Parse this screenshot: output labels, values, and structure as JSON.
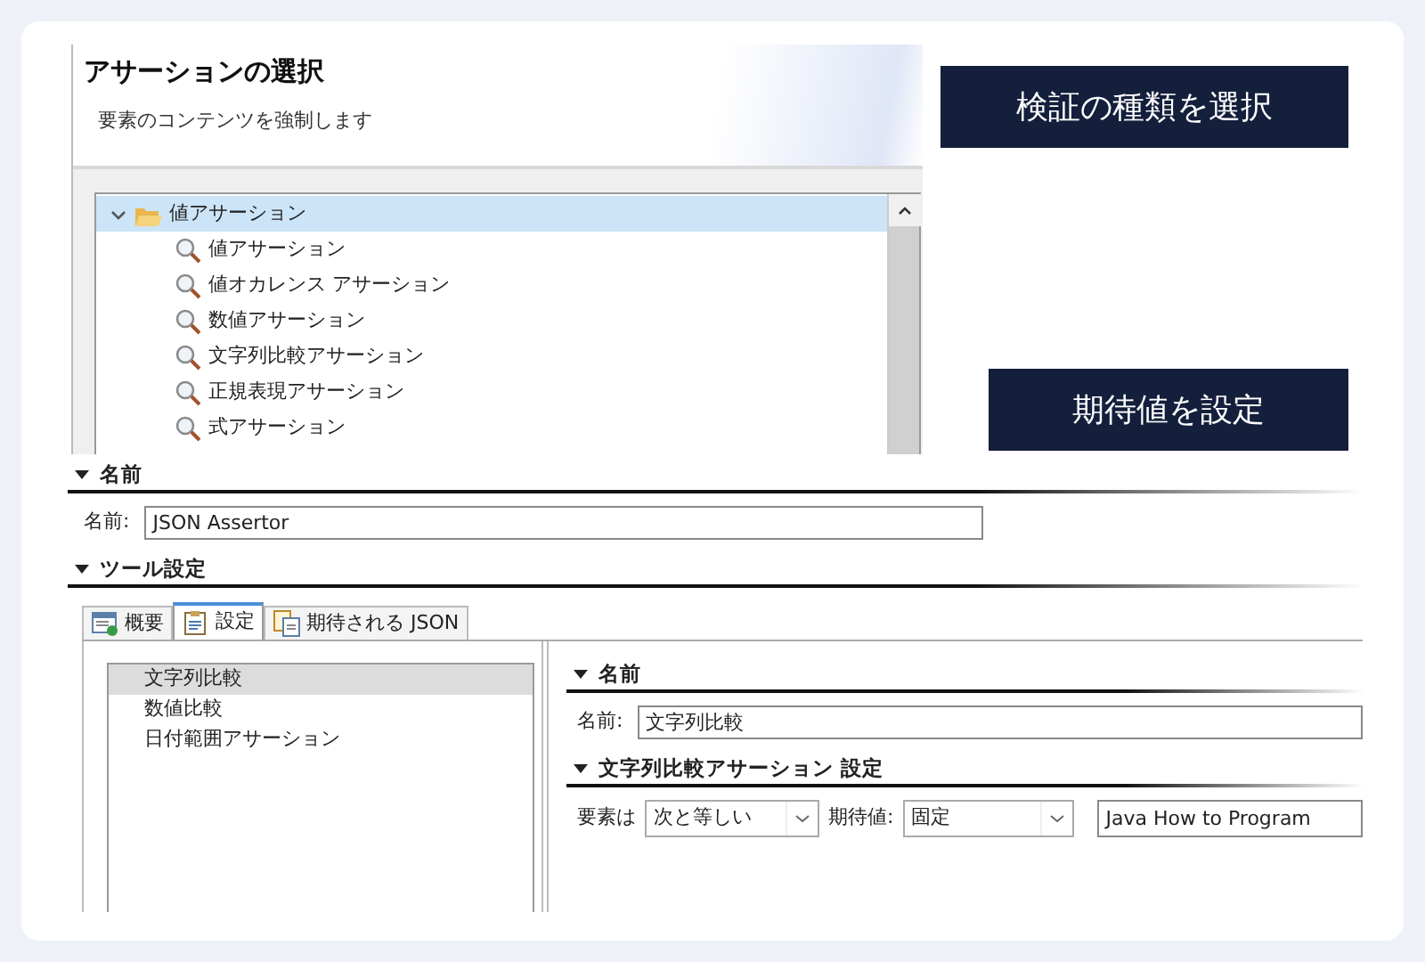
{
  "top_dialog": {
    "title": "アサーションの選択",
    "subtitle": "要素のコンテンツを強制します",
    "tree": [
      {
        "label": "値アサーション",
        "expanded": true,
        "selected": true,
        "children": [
          {
            "label": "値アサーション"
          },
          {
            "label": "値オカレンス アサーション"
          },
          {
            "label": "数値アサーション"
          },
          {
            "label": "文字列比較アサーション"
          },
          {
            "label": "正規表現アサーション"
          },
          {
            "label": "式アサーション"
          }
        ]
      }
    ]
  },
  "callouts": [
    "検証の種類を選択",
    "期待値を設定"
  ],
  "bottom_editor": {
    "name_section": {
      "title": "名前",
      "expanded": true,
      "label": "名前:",
      "value": "JSON Assertor"
    },
    "tool_section": {
      "title": "ツール設定",
      "expanded": true
    },
    "tabs": [
      {
        "label": "概要",
        "selected": false
      },
      {
        "label": "設定",
        "selected": true
      },
      {
        "label": "期待される JSON",
        "selected": false
      }
    ],
    "assertions": [
      {
        "label": "文字列比較",
        "selected": true
      },
      {
        "label": "数値比較",
        "selected": false
      },
      {
        "label": "日付範囲アサーション",
        "selected": false
      }
    ],
    "detail": {
      "name_section": {
        "title": "名前",
        "expanded": true,
        "label": "名前:",
        "value": "文字列比較"
      },
      "settings_section": {
        "title": "文字列比較アサーション 設定",
        "expanded": true,
        "element_label": "要素は",
        "element_value": "次と等しい",
        "expected_label": "期待値:",
        "expected_value": "固定",
        "text_value": "Java How to Program"
      }
    }
  }
}
